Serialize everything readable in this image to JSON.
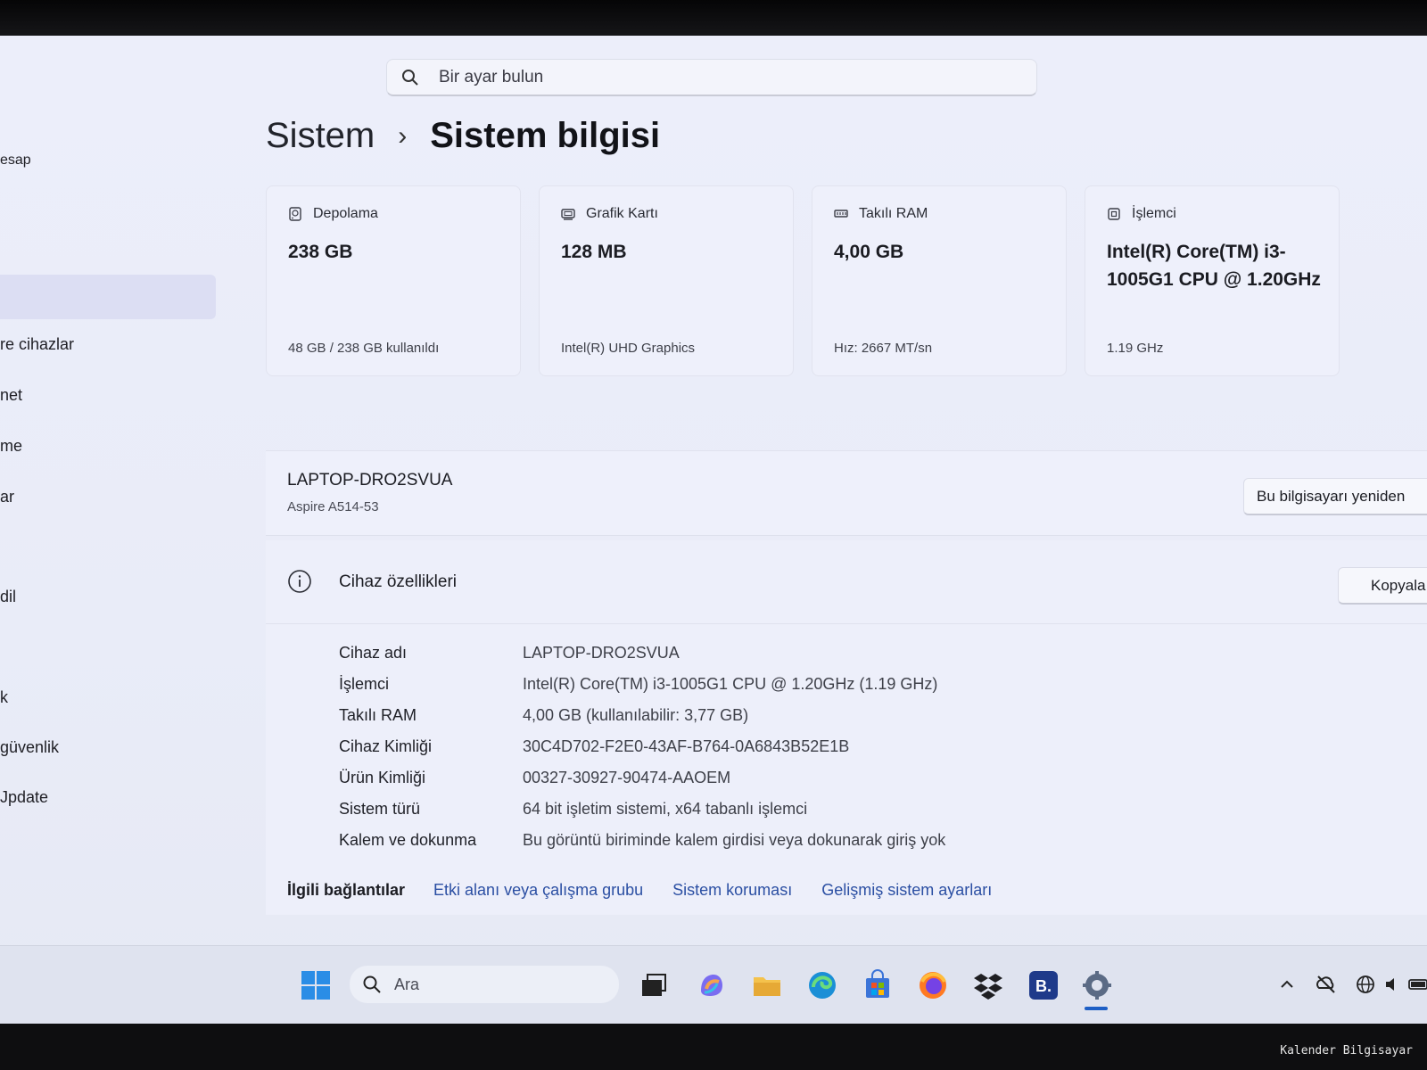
{
  "search": {
    "placeholder": "Bir ayar bulun"
  },
  "sidebar": {
    "items": [
      {
        "label": "esap"
      },
      {
        "label": "re cihazlar"
      },
      {
        "label": "net"
      },
      {
        "label": "me"
      },
      {
        "label": "ar"
      },
      {
        "label": "dil"
      },
      {
        "label": "k"
      },
      {
        "label": "güvenlik"
      },
      {
        "label": "Jpdate"
      }
    ]
  },
  "breadcrumb": {
    "parent": "Sistem",
    "separator": "›",
    "current": "Sistem bilgisi"
  },
  "cards": [
    {
      "title": "Depolama",
      "value": "238 GB",
      "sub": "48 GB / 238 GB kullanıldı",
      "icon": "storage-icon"
    },
    {
      "title": "Grafik Kartı",
      "value": "128 MB",
      "sub": "Intel(R) UHD Graphics",
      "icon": "gpu-icon"
    },
    {
      "title": "Takılı RAM",
      "value": "4,00 GB",
      "sub": "Hız: 2667 MT/sn",
      "icon": "ram-icon"
    },
    {
      "title": "İşlemci",
      "value": "Intel(R) Core(TM) i3-1005G1 CPU @ 1.20GHz",
      "sub": "1.19 GHz",
      "icon": "cpu-icon"
    }
  ],
  "device": {
    "name": "LAPTOP-DRO2SVUA",
    "model": "Aspire A514-53",
    "rename_label": "Bu bilgisayarı yeniden"
  },
  "specs": {
    "title": "Cihaz özellikleri",
    "copy_label": "Kopyala",
    "rows": [
      {
        "key": "Cihaz adı",
        "value": "LAPTOP-DRO2SVUA"
      },
      {
        "key": "İşlemci",
        "value": "Intel(R) Core(TM) i3-1005G1 CPU @ 1.20GHz (1.19 GHz)"
      },
      {
        "key": "Takılı RAM",
        "value": "4,00 GB (kullanılabilir: 3,77 GB)"
      },
      {
        "key": "Cihaz Kimliği",
        "value": "30C4D702-F2E0-43AF-B764-0A6843B52E1B"
      },
      {
        "key": "Ürün Kimliği",
        "value": "00327-30927-90474-AAOEM"
      },
      {
        "key": "Sistem türü",
        "value": "64 bit işletim sistemi, x64 tabanlı işlemci"
      },
      {
        "key": "Kalem ve dokunma",
        "value": "Bu görüntü biriminde kalem girdisi veya dokunarak giriş yok"
      }
    ]
  },
  "related": {
    "label": "İlgili bağlantılar",
    "links": [
      "Etki alanı veya çalışma grubu",
      "Sistem koruması",
      "Gelişmiş sistem ayarları"
    ]
  },
  "taskbar": {
    "search_placeholder": "Ara",
    "apps": [
      "start-icon",
      "task-view-icon",
      "copilot-icon",
      "file-explorer-icon",
      "edge-icon",
      "store-icon",
      "firefox-icon",
      "dropbox-icon",
      "booking-icon",
      "settings-icon"
    ],
    "booking_letter": "B."
  },
  "watermark": "Kalender Bilgisayar",
  "colors": {
    "accent": "#1e5fc5",
    "link": "#2b4fa3",
    "selected": "#dcdef3"
  }
}
